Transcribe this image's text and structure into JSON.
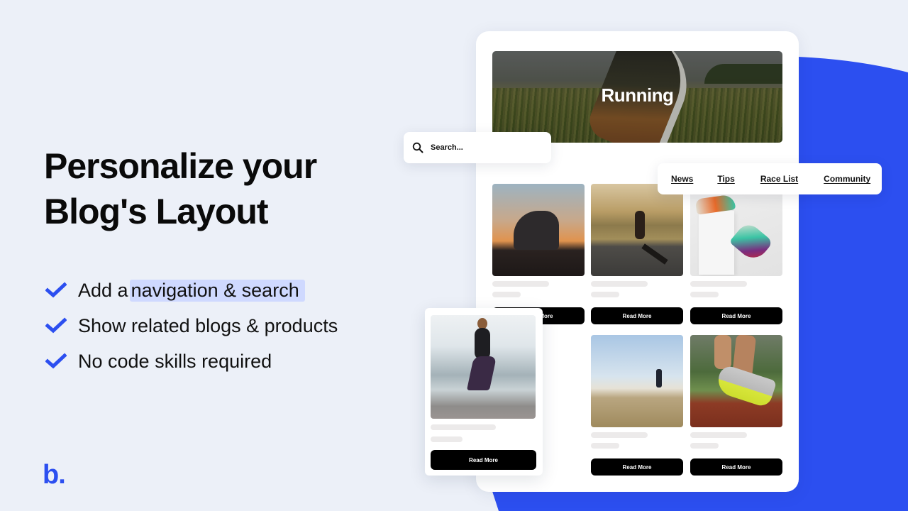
{
  "headline": {
    "line1": "Personalize your",
    "line2": "Blog's Layout"
  },
  "features": [
    {
      "prefix": "Add a",
      "highlight": "navigation & search",
      "icon": "check-icon"
    },
    {
      "text": "Show related blogs & products",
      "icon": "check-icon"
    },
    {
      "text": "No code skills required",
      "icon": "check-icon"
    }
  ],
  "logo": {
    "text": "b."
  },
  "colors": {
    "accent": "#2c4ff0",
    "background": "#ecf0f8",
    "highlight": "#cfd9ff"
  },
  "hero": {
    "title": "Running"
  },
  "search": {
    "placeholder": "Search...",
    "icon": "search-icon"
  },
  "nav": {
    "items": [
      "News",
      "Tips",
      "Race List",
      "Community"
    ]
  },
  "posts": [
    {
      "image": "shoes-at-sunset",
      "button": "Read More"
    },
    {
      "image": "runner-on-desert-road",
      "button": "Read More"
    },
    {
      "image": "colorful-sneakers-on-white",
      "button": "Read More"
    },
    {
      "image": "woman-running-by-sea",
      "button": "Read More"
    },
    {
      "image": "trail-runner-on-hill",
      "button": "Read More"
    },
    {
      "image": "running-shoes-on-track",
      "button": "Read More"
    }
  ]
}
